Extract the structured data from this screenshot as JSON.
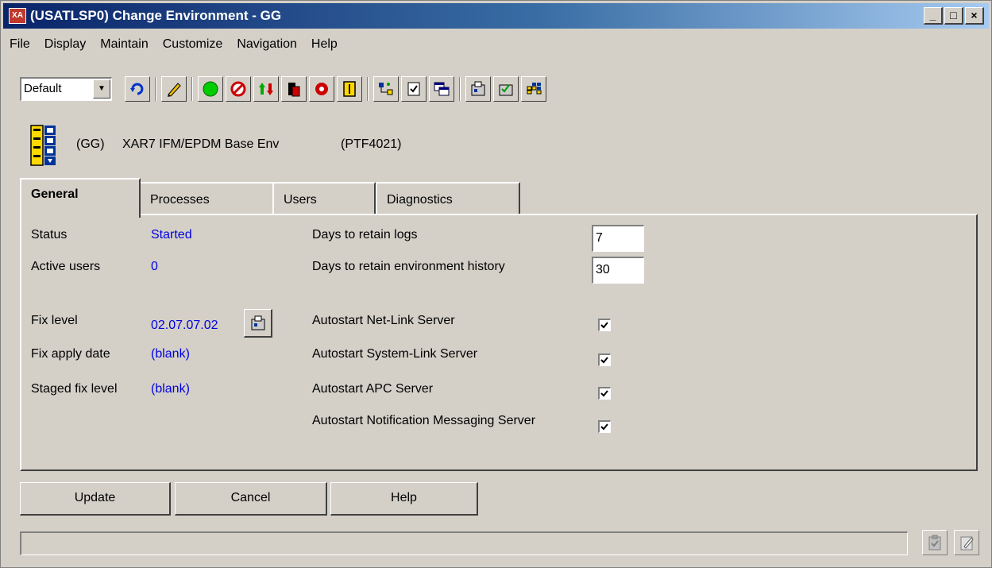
{
  "window": {
    "title": "(USATLSP0) Change Environment - GG",
    "app_badge": "XA",
    "controls": [
      "_",
      "□",
      "×"
    ]
  },
  "menu": [
    "File",
    "Display",
    "Maintain",
    "Customize",
    "Navigation",
    "Help"
  ],
  "toolbar": {
    "view_select": "Default",
    "icons": [
      "refresh-icon",
      "edit-pencil-icon",
      "start-green-icon",
      "stop-red-icon",
      "up-down-arrows-icon",
      "server-icon",
      "red-circle-icon",
      "yellow-panel-icon",
      "network-icon",
      "checklist-icon",
      "windows-icon",
      "fix-icon",
      "fix-check-icon",
      "grid-icon"
    ]
  },
  "environment": {
    "code": "(GG)",
    "name": "XAR7 IFM/EPDM Base Env",
    "ptf": "(PTF4021)"
  },
  "tabs": [
    "General",
    "Processes",
    "Users",
    "Diagnostics"
  ],
  "general": {
    "status_label": "Status",
    "status_value": "Started",
    "active_users_label": "Active users",
    "active_users_value": "0",
    "fix_level_label": "Fix level",
    "fix_level_value": "02.07.07.02",
    "fix_apply_date_label": "Fix apply date",
    "fix_apply_date_value": "(blank)",
    "staged_fix_level_label": "Staged fix level",
    "staged_fix_level_value": "(blank)",
    "days_logs_label": "Days to retain logs",
    "days_logs_value": "7",
    "days_history_label": "Days to retain environment history",
    "days_history_value": "30",
    "autostart": [
      {
        "label": "Autostart Net-Link Server",
        "checked": true
      },
      {
        "label": "Autostart System-Link Server",
        "checked": true
      },
      {
        "label": "Autostart APC Server",
        "checked": true
      },
      {
        "label": "Autostart Notification Messaging Server",
        "checked": true
      }
    ]
  },
  "buttons": {
    "update": "Update",
    "cancel": "Cancel",
    "help": "Help"
  },
  "status_bar": {
    "text": "",
    "icons": [
      "clipboard-icon",
      "edit-note-icon"
    ]
  }
}
